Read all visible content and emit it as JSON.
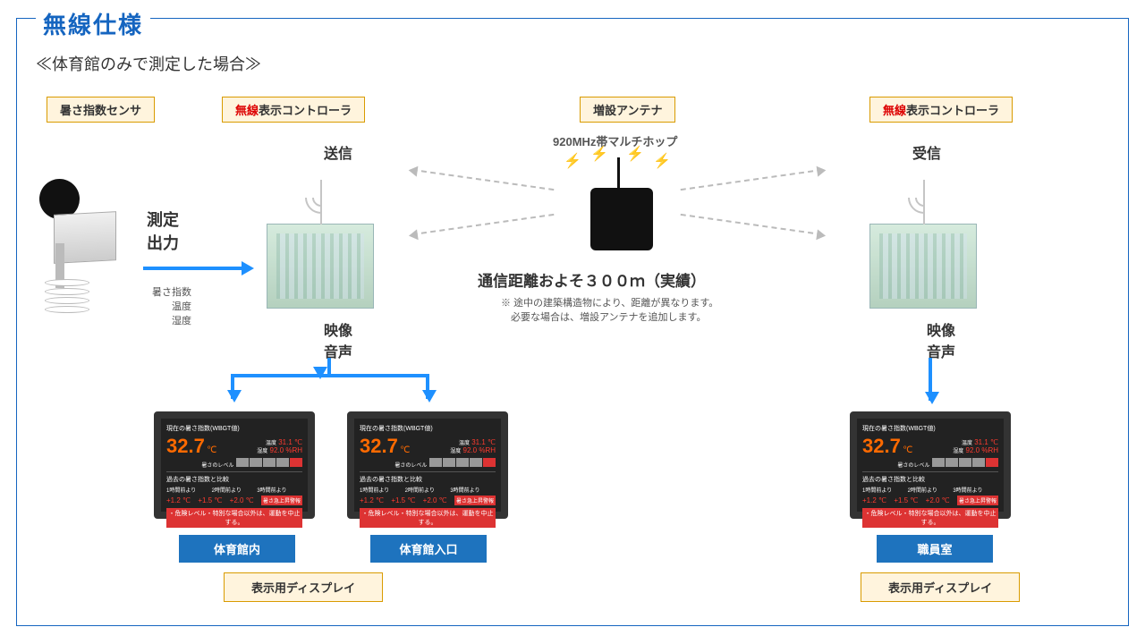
{
  "title": "無線仕様",
  "subtitle": "≪体育館のみで測定した場合≫",
  "labels": {
    "sensor": "暑さ指数センサ",
    "controller_prefix": "無線",
    "controller_suffix": "表示コントローラ",
    "antenna": "増設アンテナ",
    "display_unit": "表示用ディスプレイ"
  },
  "antenna_sub": "920MHz帯マルチホップ",
  "distance_heading": "通信距離およそ３００ｍ（実績）",
  "distance_note1": "※ 途中の建築構造物により、距離が異なります。",
  "distance_note2": "　必要な場合は、増設アンテナを追加します。",
  "tx": "送信",
  "rx": "受信",
  "measure": "測定\n出力",
  "metrics": "暑さ指数\n温度\n湿度",
  "av": "映像\n音声",
  "locations": {
    "gym_inside": "体育館内",
    "gym_entrance": "体育館入口",
    "staff_room": "職員室"
  },
  "display_data": {
    "header": "現在の暑さ指数(WBGT値)",
    "wbgt": "32.7",
    "wbgt_unit": "℃",
    "temp_label": "温度",
    "temp": "31.1 ℃",
    "hum_label": "湿度",
    "hum": "92.0 %RH",
    "level_label": "暑さのレベル",
    "compare": "過去の暑さ指数と比較",
    "c1l": "1時間前より",
    "c1": "+1.2 ℃",
    "c2l": "2時間前より",
    "c2": "+1.5 ℃",
    "c3l": "3時間前より",
    "c3": "+2.0 ℃",
    "alert": "暑さ急上昇警報",
    "footer": "・危険レベル・特別な場合以外は、運動を中止する。"
  }
}
